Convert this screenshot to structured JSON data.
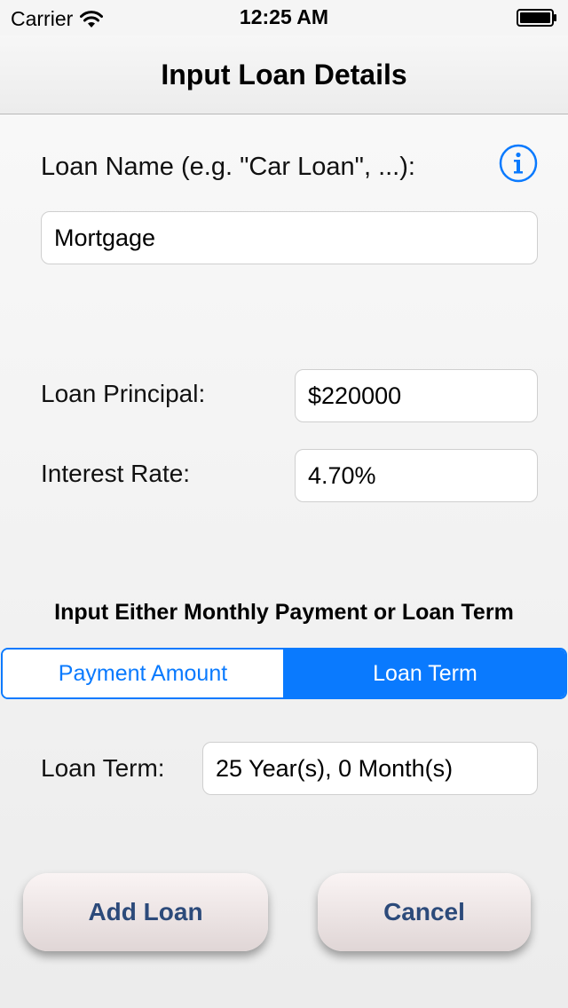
{
  "status_bar": {
    "carrier": "Carrier",
    "time": "12:25 AM"
  },
  "nav": {
    "title": "Input Loan Details"
  },
  "form": {
    "loan_name_label": "Loan Name (e.g. \"Car Loan\", ...):",
    "loan_name_value": "Mortgage",
    "principal_label": "Loan Principal:",
    "principal_value": "$220000",
    "rate_label": "Interest Rate:",
    "rate_value": "4.70%",
    "section_title": "Input Either Monthly Payment or Loan Term",
    "segments": [
      {
        "label": "Payment Amount",
        "selected": false
      },
      {
        "label": "Loan Term",
        "selected": true
      }
    ],
    "term_label": "Loan Term:",
    "term_value": "25 Year(s), 0 Month(s)"
  },
  "buttons": {
    "add": "Add Loan",
    "cancel": "Cancel"
  },
  "icons": {
    "info": "info-icon",
    "wifi": "wifi-icon",
    "battery": "battery-icon"
  },
  "colors": {
    "accent": "#0a7afe",
    "button_text": "#2c4a7a"
  }
}
